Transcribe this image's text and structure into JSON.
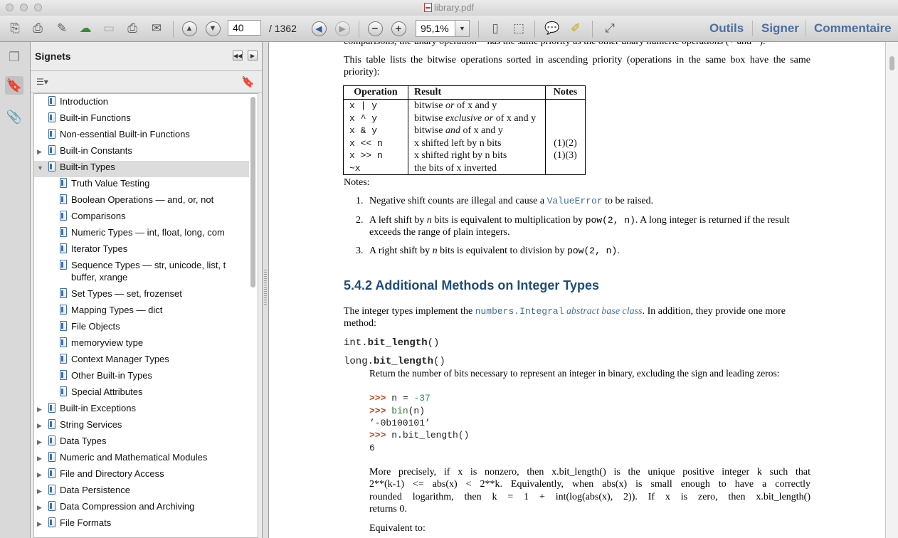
{
  "window": {
    "title": "library.pdf"
  },
  "toolbar": {
    "page_current": "40",
    "page_total": "/ 1362",
    "zoom": "95,1%",
    "menus": [
      "Outils",
      "Signer",
      "Commentaire"
    ]
  },
  "sidebar": {
    "title": "Signets",
    "bookmarks": [
      {
        "label": "Introduction"
      },
      {
        "label": "Built-in Functions"
      },
      {
        "label": "Non-essential Built-in Functions"
      },
      {
        "label": "Built-in Constants"
      },
      {
        "label": "Built-in Types"
      },
      {
        "label": "Truth Value Testing"
      },
      {
        "label": "Boolean Operations — and, or, not"
      },
      {
        "label": "Comparisons"
      },
      {
        "label": "Numeric Types — int, float, long, com"
      },
      {
        "label": "Iterator Types"
      },
      {
        "label": "Sequence Types — str, unicode, list, t",
        "label2": "buffer, xrange"
      },
      {
        "label": "Set Types — set, frozenset"
      },
      {
        "label": "Mapping Types — dict"
      },
      {
        "label": "File Objects"
      },
      {
        "label": "memoryview type"
      },
      {
        "label": "Context Manager Types"
      },
      {
        "label": "Other Built-in Types"
      },
      {
        "label": "Special Attributes"
      },
      {
        "label": "Built-in Exceptions"
      },
      {
        "label": "String Services"
      },
      {
        "label": "Data Types"
      },
      {
        "label": "Numeric and Mathematical Modules"
      },
      {
        "label": "File and Directory Access"
      },
      {
        "label": "Data Persistence"
      },
      {
        "label": "Data Compression and Archiving"
      },
      {
        "label": "File Formats"
      }
    ]
  },
  "doc": {
    "top_fragment": "comparisons; the unary operation ~ has the same priority as the other unary numeric operations (+ and −).",
    "intro_line1": "This table lists the bitwise operations sorted in ascending priority (operations in the same box have the same",
    "intro_line2": "priority):",
    "table": {
      "headers": [
        "Operation",
        "Result",
        "Notes"
      ],
      "rows": [
        {
          "op": "x | y",
          "res_a": "bitwise ",
          "res_i": "or",
          "res_b": " of x and y",
          "notes": ""
        },
        {
          "op": "x ^ y",
          "res_a": "bitwise ",
          "res_i": "exclusive or",
          "res_b": " of x and y",
          "notes": ""
        },
        {
          "op": "x & y",
          "res_a": "bitwise ",
          "res_i": "and",
          "res_b": " of x and y",
          "notes": ""
        },
        {
          "op": "x << n",
          "res_a": "x shifted left by n bits",
          "res_i": "",
          "res_b": "",
          "notes": "(1)(2)"
        },
        {
          "op": "x >> n",
          "res_a": "x shifted right by n bits",
          "res_i": "",
          "res_b": "",
          "notes": "(1)(3)"
        },
        {
          "op": "~x",
          "res_a": "the bits of x inverted",
          "res_i": "",
          "res_b": "",
          "notes": ""
        }
      ]
    },
    "notes_heading": "Notes:",
    "note1_num": "1.",
    "note1_a": "Negative shift counts are illegal and cause a ",
    "note1_code": "ValueError",
    "note1_b": " to be raised.",
    "note2_num": "2.",
    "note2_a": "A left shift by ",
    "note2_i": "n",
    "note2_b": " bits is equivalent to multiplication by ",
    "note2_code": "pow(2, n)",
    "note2_c": ". A long integer is returned if the result",
    "note2_line2": "exceeds the range of plain integers.",
    "note3_num": "3.",
    "note3_a": "A right shift by ",
    "note3_i": "n",
    "note3_b": " bits is equivalent to division by ",
    "note3_code": "pow(2, n)",
    "note3_c": ".",
    "section_heading": "5.4.2  Additional Methods on Integer Types",
    "int_para_a": "The integer types implement the ",
    "int_para_code": "numbers.Integral",
    "int_para_i": " abstract base class",
    "int_para_b": ". In addition, they provide one more",
    "int_para_line2": "method:",
    "sig1_prefix": "int.",
    "sig1_name": "bit_length",
    "sig1_suffix": "()",
    "sig2_prefix": "long.",
    "sig2_name": "bit_length",
    "sig2_suffix": "()",
    "return_desc": "Return the number of bits necessary to represent an integer in binary, excluding the sign and leading zeros:",
    "code": {
      "p": ">>>",
      "l1_a": "n = ",
      "l1_b": "-37",
      "l2_a": "bin",
      "l2_b": "(n)",
      "l3": "’-0b100101’",
      "l4": "n.bit_length()",
      "l5": "6"
    },
    "more_line1": "More precisely, if x is nonzero, then x.bit_length() is the unique positive integer k such that",
    "more_line2": "2**(k-1) <= abs(x) < 2**k. Equivalently, when abs(x) is small enough to have a correctly",
    "more_line3": "rounded logarithm, then k = 1 + int(log(abs(x), 2)). If x is zero, then x.bit_length()",
    "more_line4": "returns 0.",
    "equiv": "Equivalent to:"
  }
}
